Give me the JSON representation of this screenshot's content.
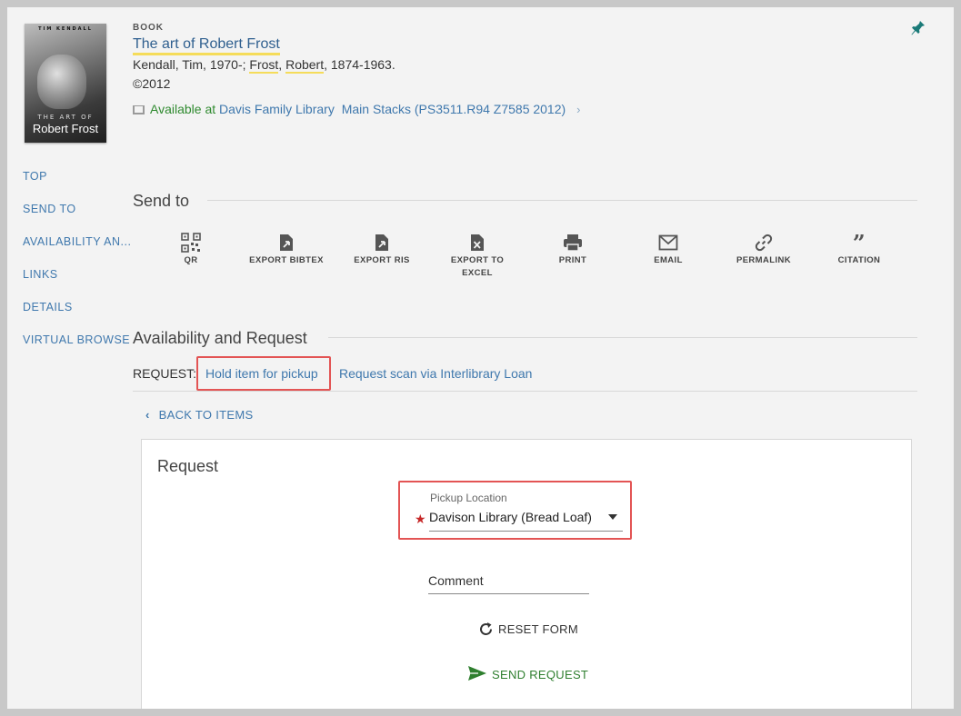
{
  "record": {
    "type": "BOOK",
    "title": "The art of Robert Frost",
    "author1": "Kendall, Tim, 1970-; ",
    "author2_last": "Frost",
    "author2_sep": ", ",
    "author2_first": "Robert",
    "author2_dates": ", 1874-1963.",
    "date": "©2012",
    "availability_status": "Available at",
    "library": "Davis Family Library",
    "location": "Main Stacks (PS3511.R94 Z7585 2012)",
    "cover": {
      "author": "TIM KENDALL",
      "art": "THE ART OF",
      "name": "Robert Frost"
    }
  },
  "nav": [
    "TOP",
    "SEND TO",
    "AVAILABILITY AN...",
    "LINKS",
    "DETAILS",
    "VIRTUAL BROWSE"
  ],
  "send_to": {
    "title": "Send to",
    "actions": [
      {
        "label": "QR",
        "icon": "qr-code-icon"
      },
      {
        "label": "EXPORT BIBTEX",
        "icon": "export-file-icon"
      },
      {
        "label": "EXPORT RIS",
        "icon": "export-file-icon"
      },
      {
        "label": "EXPORT TO EXCEL",
        "icon": "excel-file-icon"
      },
      {
        "label": "PRINT",
        "icon": "printer-icon"
      },
      {
        "label": "EMAIL",
        "icon": "envelope-icon"
      },
      {
        "label": "PERMALINK",
        "icon": "link-icon"
      },
      {
        "label": "CITATION",
        "icon": "quote-icon"
      }
    ]
  },
  "availability": {
    "title": "Availability and Request",
    "request_label": "REQUEST:",
    "option_hold": "Hold item for pickup",
    "option_scan": "Request scan via Interlibrary Loan",
    "back": "BACK TO ITEMS"
  },
  "request_form": {
    "title": "Request",
    "pickup_label": "Pickup Location",
    "pickup_value": "Davison Library (Bread Loaf)",
    "comment_placeholder": "Comment",
    "reset": "RESET FORM",
    "send": "SEND REQUEST",
    "send_color": "#2f7f2f"
  },
  "colors": {
    "link": "#3f78ad",
    "highlight": "#e35454",
    "available": "#2f8a2f",
    "pin": "#1a7a78"
  }
}
